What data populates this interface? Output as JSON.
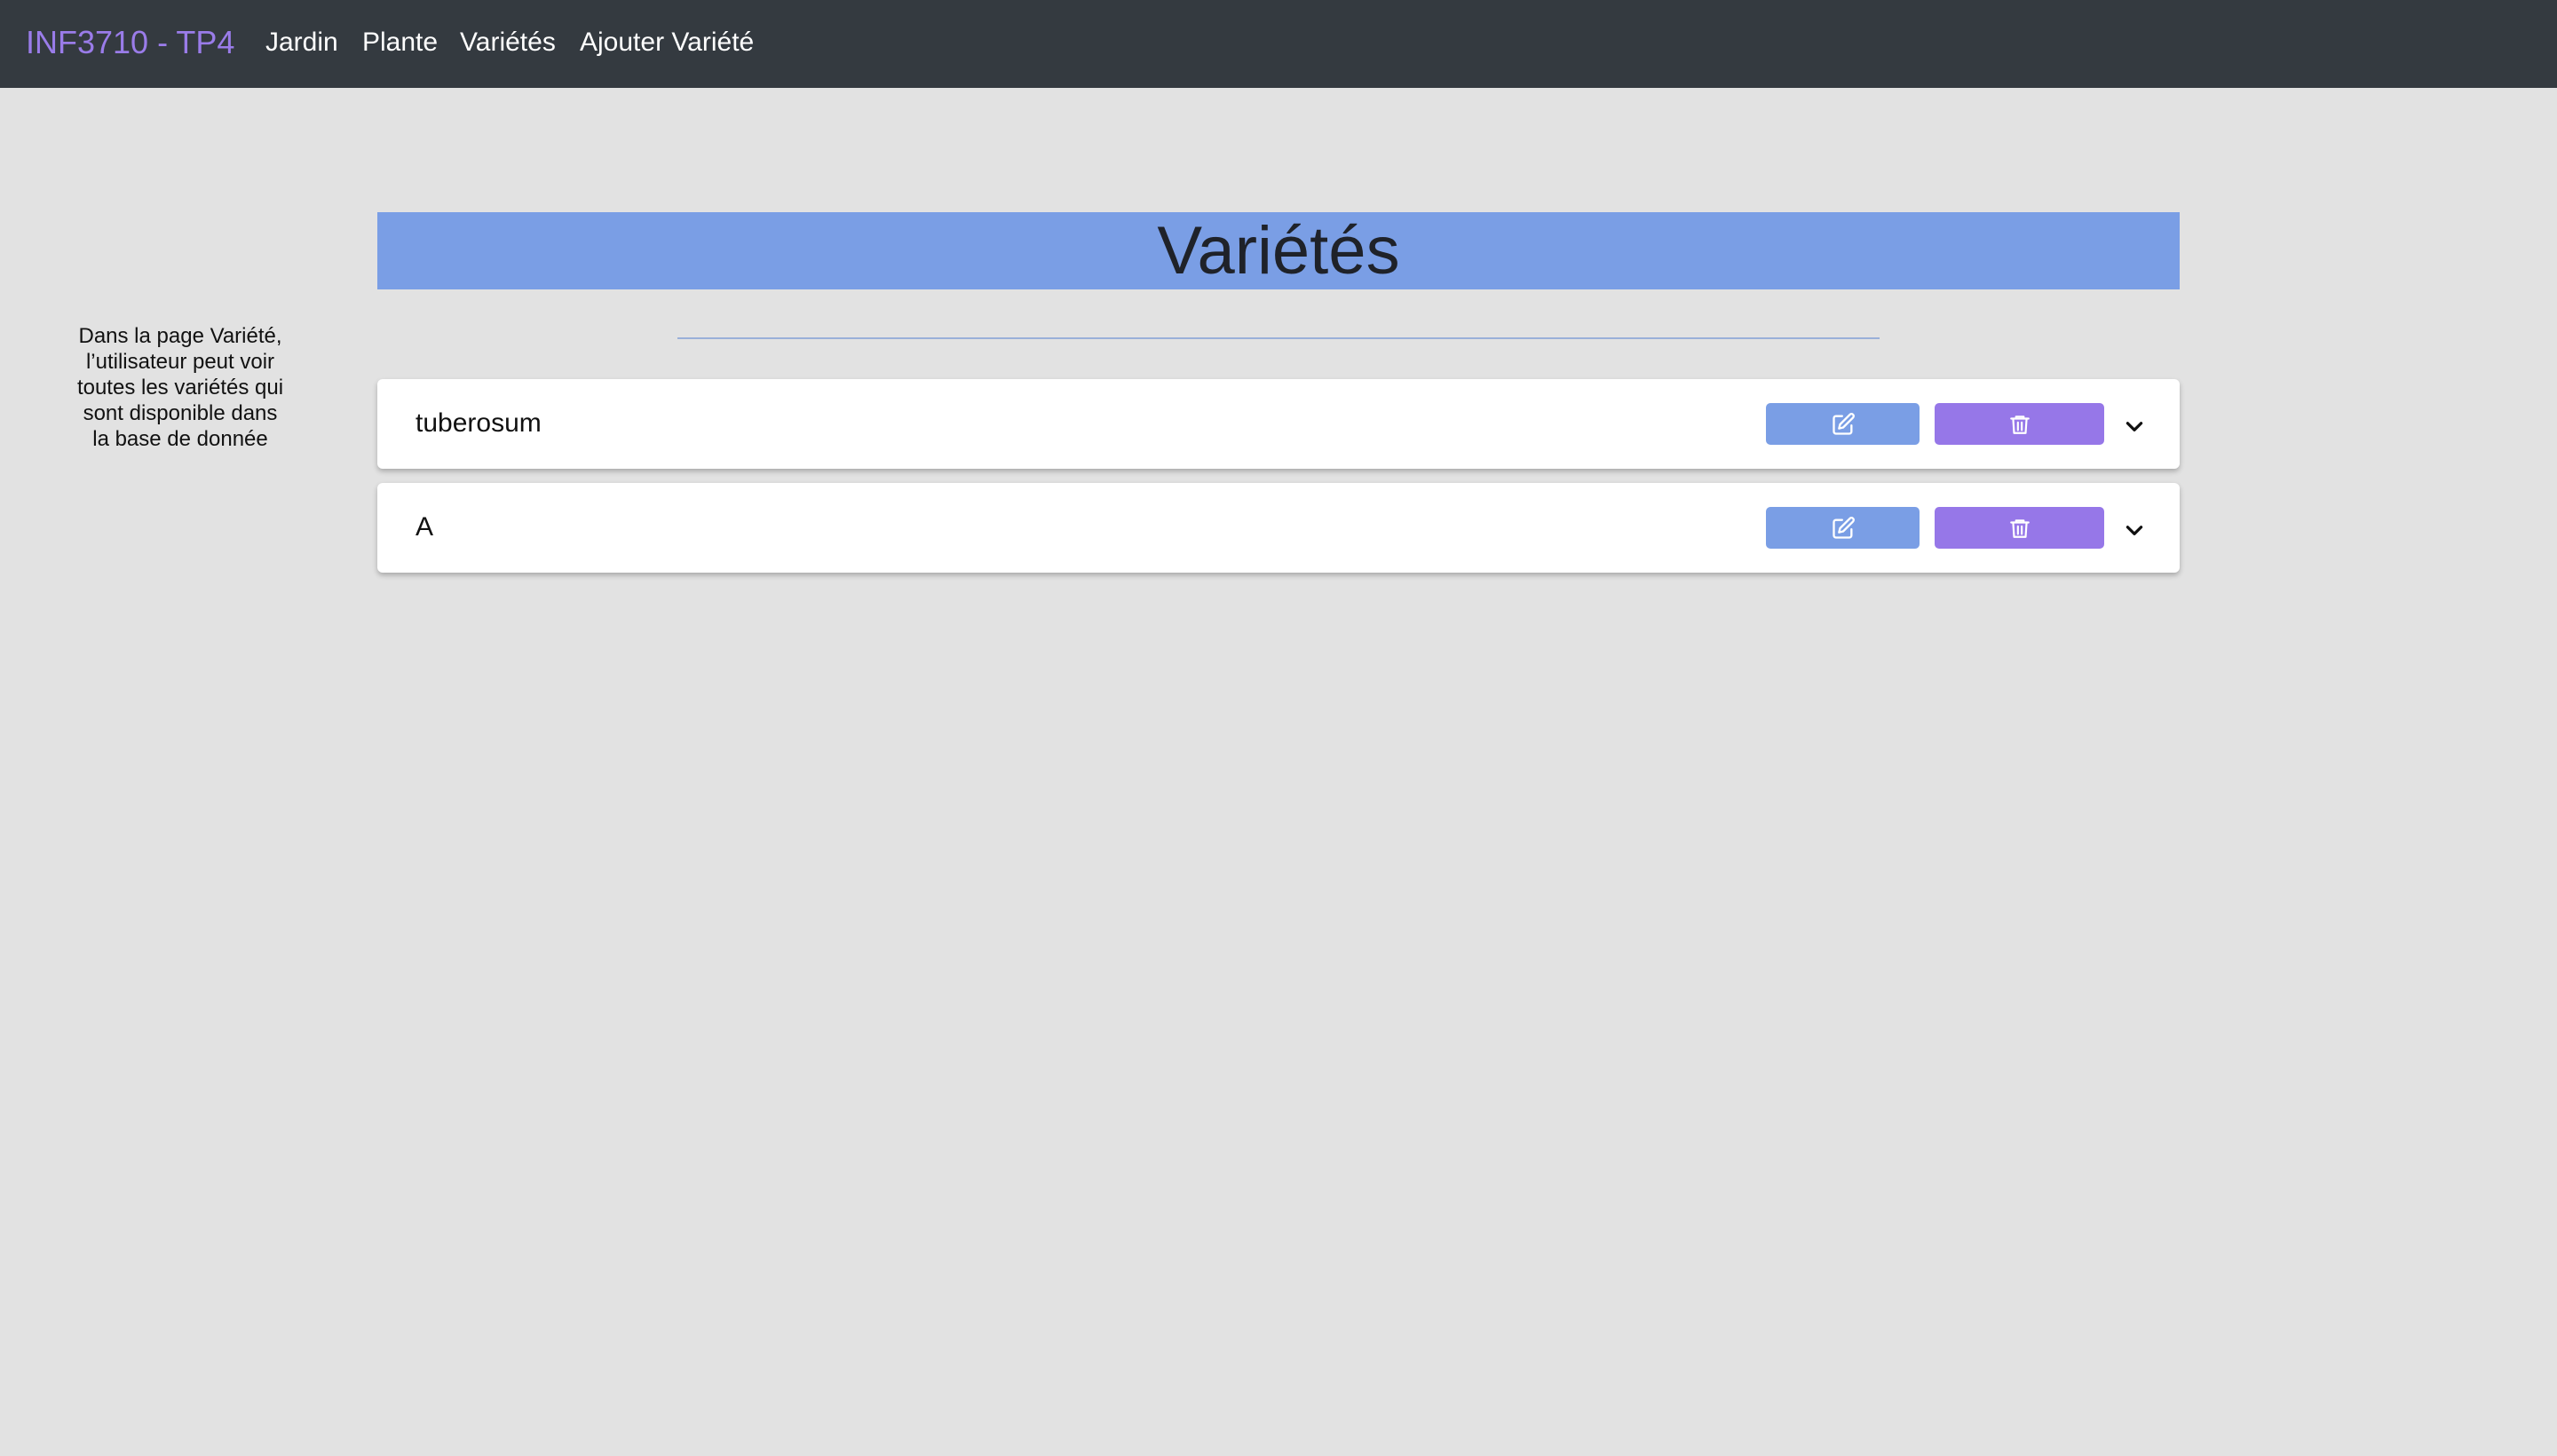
{
  "navbar": {
    "brand": "INF3710 - TP4",
    "links": [
      "Jardin",
      "Plante",
      "Variétés",
      "Ajouter Variété"
    ]
  },
  "side_note": {
    "lines": [
      "Dans la page Variété,",
      "l’utilisateur peut voir",
      "toutes les variétés qui",
      "sont disponible dans",
      "la base de donnée"
    ]
  },
  "page": {
    "title": "Variétés"
  },
  "varieties": [
    {
      "name": "tuberosum"
    },
    {
      "name": "A"
    }
  ],
  "colors": {
    "navbar_bg": "#343a40",
    "brand": "#9a7ce9",
    "page_bg": "#e2e2e2",
    "banner": "#7a9ee5",
    "edit_button": "#7a9ee5",
    "delete_button": "#9677e8"
  },
  "icons": {
    "edit": "edit-icon",
    "delete": "trash-icon",
    "expand": "chevron-down-icon"
  }
}
